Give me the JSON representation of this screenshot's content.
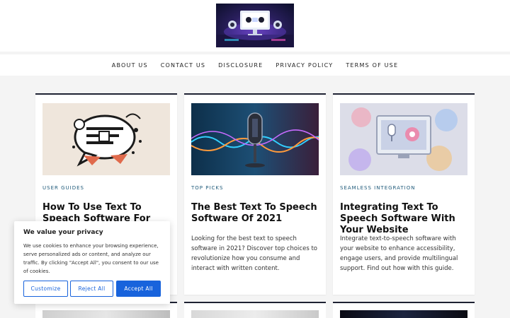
{
  "header": {
    "logo_icon": "logo-monitor-icon"
  },
  "nav": {
    "items": [
      {
        "label": "ABOUT US"
      },
      {
        "label": "CONTACT US"
      },
      {
        "label": "DISCLOSURE"
      },
      {
        "label": "PRIVACY POLICY"
      },
      {
        "label": "TERMS OF USE"
      }
    ]
  },
  "posts": [
    {
      "category": "USER GUIDES",
      "title": "How To Use Text To Speach Software For Beginners",
      "excerpt": ""
    },
    {
      "category": "TOP PICKS",
      "title": "The Best Text To Speech Software Of 2021",
      "excerpt": "Looking for the best text to speech software in 2021? Discover top choices to revolutionize how you consume and interact with written content."
    },
    {
      "category": "SEAMLESS INTEGRATION",
      "title": "Integrating Text To Speech Software With Your Website",
      "excerpt": "Integrate text-to-speech software with your website to enhance accessibility, engage users, and provide multilingual support. Find out how with this guide."
    }
  ],
  "cookie_banner": {
    "title": "We value your privacy",
    "text": "We use cookies to enhance your browsing experience, serve personalized ads or content, and analyze our traffic. By clicking \"Accept All\", you consent to our use of cookies.",
    "customize_label": "Customize",
    "reject_label": "Reject All",
    "accept_label": "Accept All",
    "accent_color": "#1863dc"
  }
}
